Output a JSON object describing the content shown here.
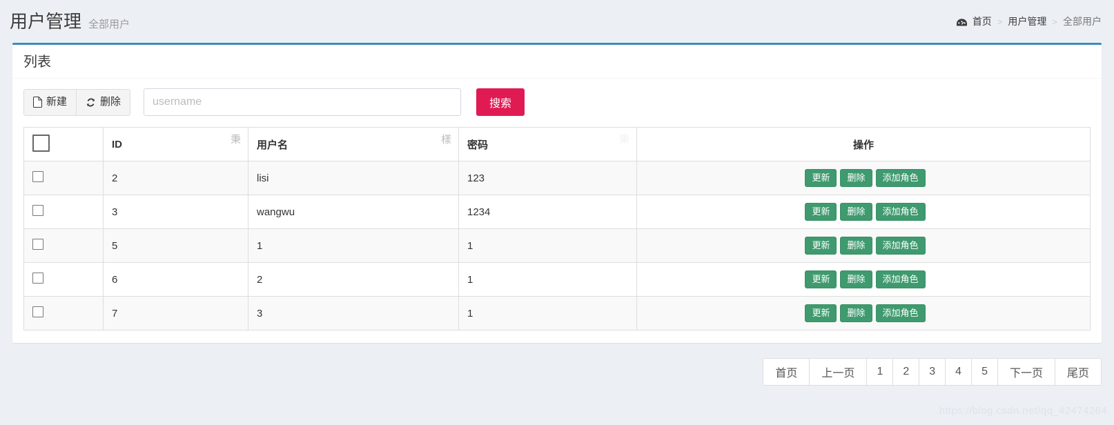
{
  "header": {
    "title": "用户管理",
    "subtitle": "全部用户",
    "breadcrumb": {
      "home_icon": "dashboard-icon",
      "items": [
        "首页",
        "用户管理",
        "全部用户"
      ],
      "separator": ">"
    }
  },
  "box": {
    "title": "列表"
  },
  "toolbar": {
    "new_label": "新建",
    "new_icon": "file-icon",
    "delete_label": "删除",
    "delete_icon": "refresh-icon",
    "search_placeholder": "username",
    "search_value": "",
    "search_button": "搜索"
  },
  "table": {
    "columns": [
      {
        "key": "check",
        "label": "",
        "sort_glyph": ""
      },
      {
        "key": "id",
        "label": "ID",
        "sort_glyph": "秉"
      },
      {
        "key": "username",
        "label": "用户名",
        "sort_glyph": "樣"
      },
      {
        "key": "password",
        "label": "密码",
        "sort_glyph": "秉"
      },
      {
        "key": "ops",
        "label": "操作",
        "sort_glyph": ""
      }
    ],
    "row_actions": [
      "更新",
      "删除",
      "添加角色"
    ],
    "rows": [
      {
        "id": "2",
        "username": "lisi",
        "password": "123",
        "checked": false
      },
      {
        "id": "3",
        "username": "wangwu",
        "password": "1234",
        "checked": false
      },
      {
        "id": "5",
        "username": "1",
        "password": "1",
        "checked": false
      },
      {
        "id": "6",
        "username": "2",
        "password": "1",
        "checked": false
      },
      {
        "id": "7",
        "username": "3",
        "password": "1",
        "checked": false
      }
    ]
  },
  "pagination": {
    "first": "首页",
    "prev": "上一页",
    "pages": [
      "1",
      "2",
      "3",
      "4",
      "5"
    ],
    "next": "下一页",
    "last": "尾页"
  },
  "watermark": "https://blog.csdn.net/qq_42474264",
  "colors": {
    "panel_top": "#3c8dbc",
    "search_button": "#e01b54",
    "action_button": "#3f9a6f",
    "page_background": "#ecf0f5"
  }
}
